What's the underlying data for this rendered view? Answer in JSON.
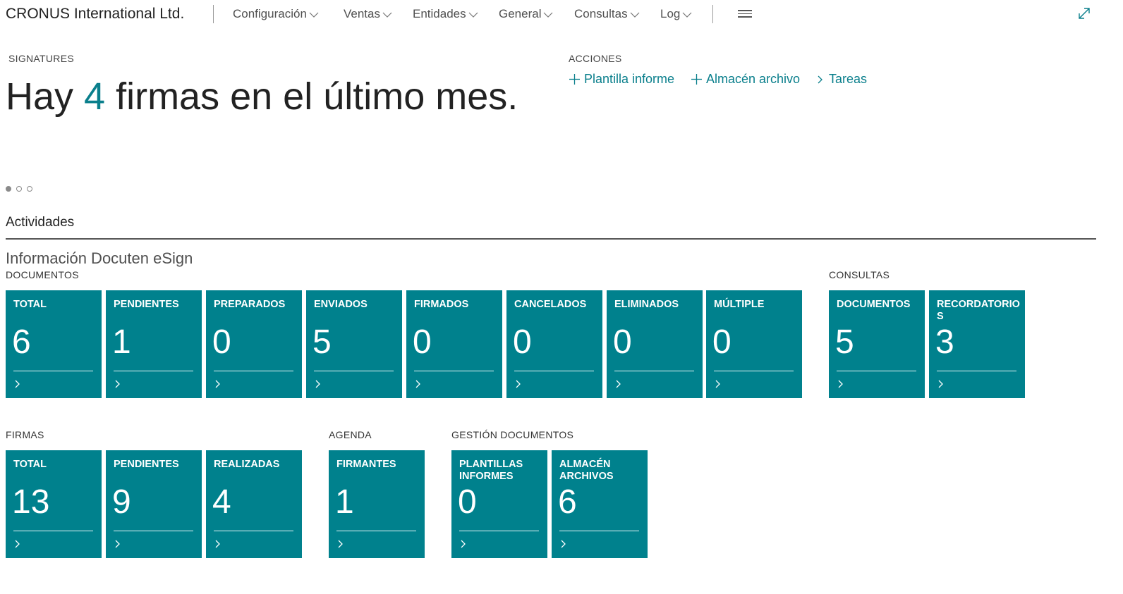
{
  "header": {
    "company": "CRONUS International Ltd.",
    "nav": [
      "Configuración",
      "Ventas",
      "Entidades",
      "General",
      "Consultas",
      "Log"
    ]
  },
  "headline": {
    "caption": "SIGNATURES",
    "prefix": "Hay ",
    "count": "4",
    "suffix": " firmas en el último mes."
  },
  "actions": {
    "caption": "ACCIONES",
    "items": [
      "Plantilla informe",
      "Almacén archivo",
      "Tareas"
    ]
  },
  "carousel": {
    "pages": 3,
    "active": 1
  },
  "activities": {
    "title": "Actividades",
    "section": "Información Docuten eSign",
    "groups": {
      "documentos": {
        "label": "DOCUMENTOS",
        "tiles": [
          {
            "label": "TOTAL",
            "value": "6"
          },
          {
            "label": "PENDIENTES",
            "value": "1"
          },
          {
            "label": "PREPARADOS",
            "value": "0"
          },
          {
            "label": "ENVIADOS",
            "value": "5"
          },
          {
            "label": "FIRMADOS",
            "value": "0"
          },
          {
            "label": "CANCELADOS",
            "value": "0"
          },
          {
            "label": "ELIMINADOS",
            "value": "0"
          },
          {
            "label": "MÚLTIPLE",
            "value": "0"
          }
        ]
      },
      "consultas": {
        "label": "CONSULTAS",
        "tiles": [
          {
            "label": "DOCUMENTOS",
            "value": "5"
          },
          {
            "label": "RECORDATORIOS",
            "value": "3"
          }
        ]
      },
      "firmas": {
        "label": "FIRMAS",
        "tiles": [
          {
            "label": "TOTAL",
            "value": "13"
          },
          {
            "label": "PENDIENTES",
            "value": "9"
          },
          {
            "label": "REALIZADAS",
            "value": "4"
          }
        ]
      },
      "agenda": {
        "label": "AGENDA",
        "tiles": [
          {
            "label": "FIRMANTES",
            "value": "1"
          }
        ]
      },
      "gestion": {
        "label": "GESTIÓN DOCUMENTOS",
        "tiles": [
          {
            "label": "PLANTILLAS INFORMES",
            "value": "0"
          },
          {
            "label": "ALMACÉN ARCHIVOS",
            "value": "6"
          }
        ]
      }
    }
  },
  "colors": {
    "tile": "#00818d",
    "accent": "#0a7f8c"
  }
}
